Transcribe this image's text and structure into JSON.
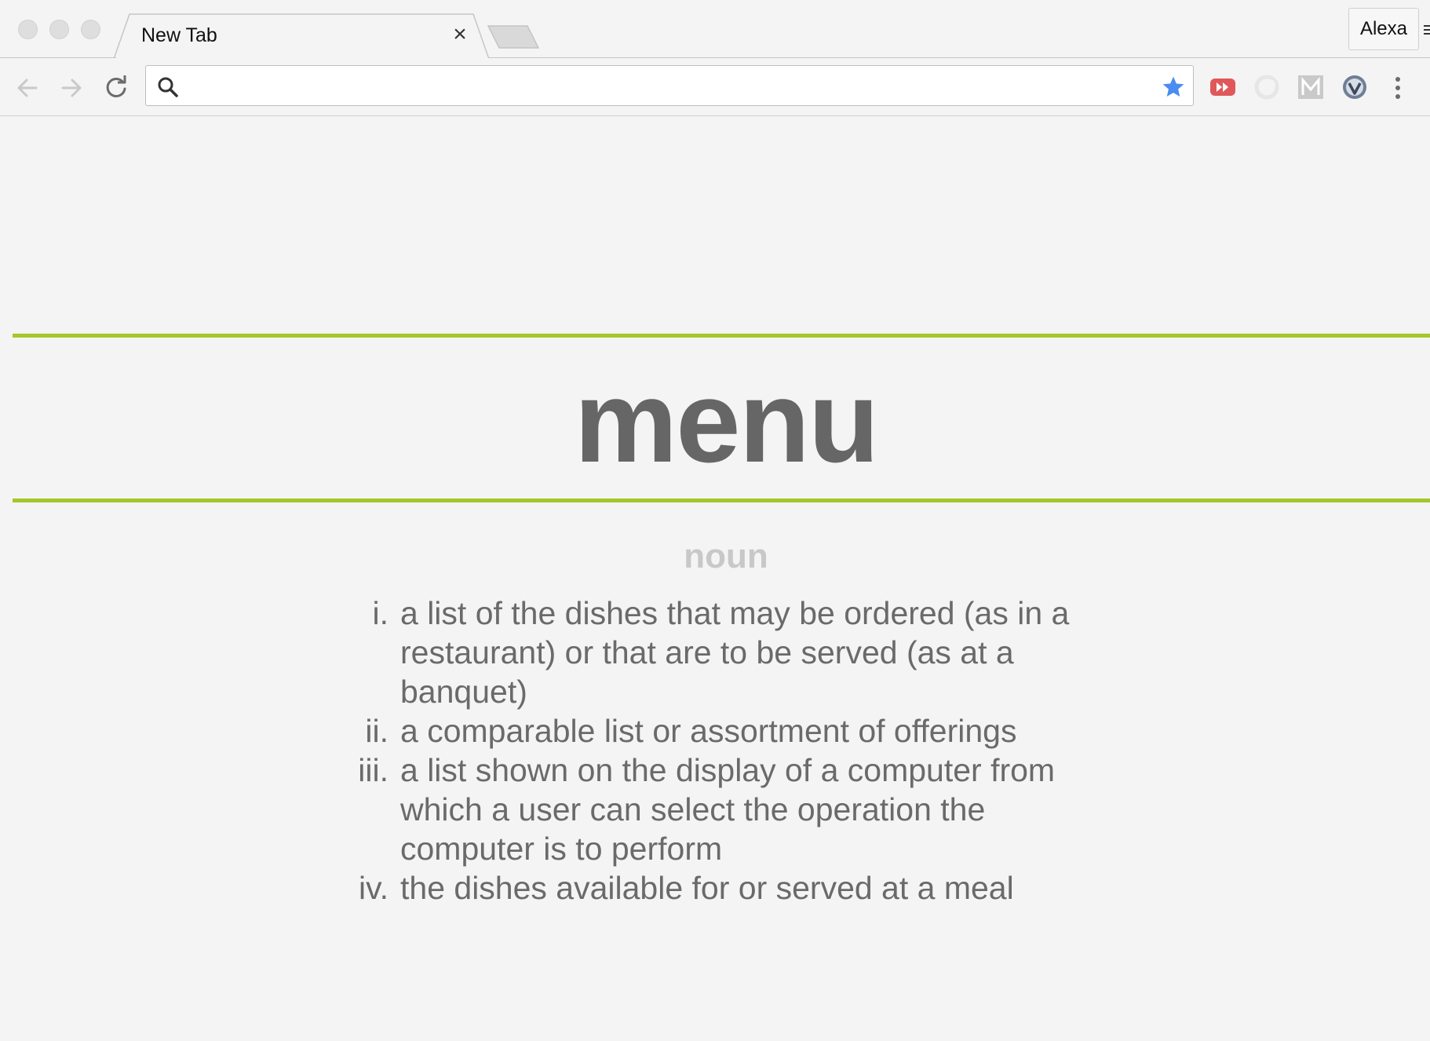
{
  "browser": {
    "tab": {
      "title": "New Tab",
      "close_glyph": "×"
    },
    "profile": {
      "label": "Alexa"
    },
    "toolbar": {
      "back_icon": "arrow-left-icon",
      "forward_icon": "arrow-right-icon",
      "reload_icon": "reload-icon",
      "bookmark_icon": "star-icon",
      "menu_icon": "three-dots-vertical-icon"
    },
    "omnibox": {
      "value": "",
      "placeholder": "",
      "search_icon": "search-icon"
    },
    "extensions": [
      {
        "name": "fast-forward-extension-icon",
        "color": "#e0585a"
      },
      {
        "name": "ghost-circle-extension-icon",
        "color": "#e6e6e6"
      },
      {
        "name": "m-extension-icon",
        "label": "M",
        "color": "#c9c9c9"
      },
      {
        "name": "v-shield-extension-icon",
        "color": "#6f7f95"
      }
    ]
  },
  "page": {
    "word": "menu",
    "part_of_speech": "noun",
    "accent_color": "#a4c72a",
    "definitions": [
      {
        "marker": "i.",
        "text": "a list of the dishes that may be ordered (as in a restaurant) or that are to be served (as at a banquet)"
      },
      {
        "marker": "ii.",
        "text": "a comparable list or assortment of offerings"
      },
      {
        "marker": "iii.",
        "text": "a list shown on the display of a computer from which a user can select the operation the computer is to perform"
      },
      {
        "marker": "iv.",
        "text": "the dishes available for or served at a meal"
      }
    ]
  }
}
